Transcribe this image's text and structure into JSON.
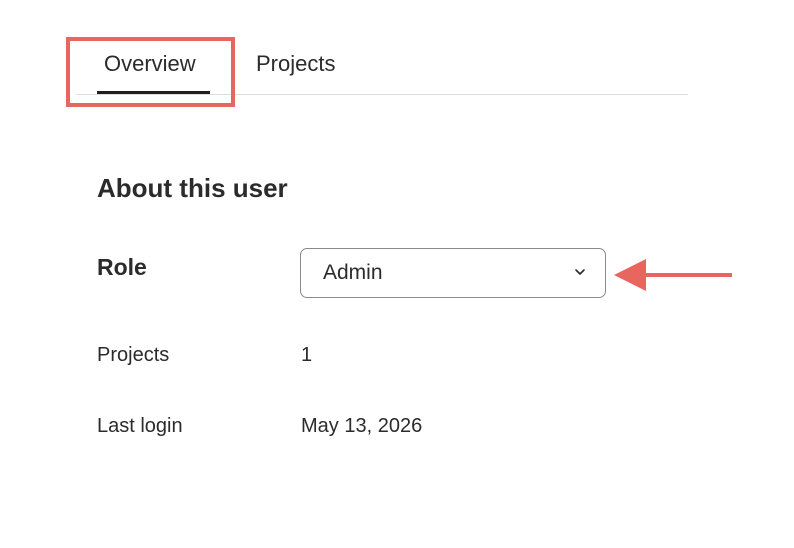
{
  "tabs": [
    {
      "label": "Overview",
      "active": true
    },
    {
      "label": "Projects",
      "active": false
    }
  ],
  "section": {
    "title": "About this user"
  },
  "fields": {
    "role_label": "Role",
    "role_value": "Admin",
    "projects_label": "Projects",
    "projects_value": "1",
    "last_login_label": "Last login",
    "last_login_value": "May 13, 2026"
  },
  "icons": {
    "select_chevron": "chevron-down-icon",
    "annotation_arrow": "arrow-left-icon"
  },
  "colors": {
    "annotation": "#e8665f",
    "text": "#2b2b2b",
    "divider": "#dcdcdc"
  }
}
